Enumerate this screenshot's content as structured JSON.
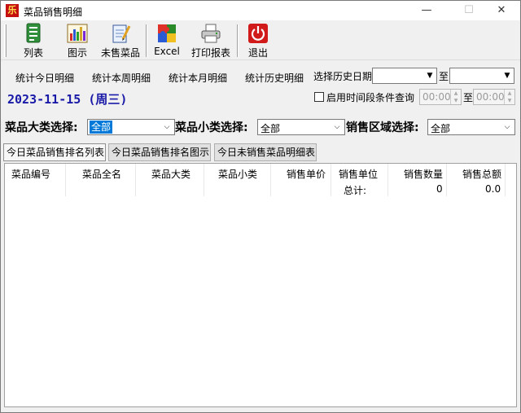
{
  "window": {
    "app_icon_text": "乐",
    "title": "菜品销售明细",
    "min_glyph": "—",
    "max_glyph": "☐",
    "close_glyph": "✕"
  },
  "toolbar": {
    "items": [
      {
        "label": "列表",
        "icon": "list-icon"
      },
      {
        "label": "图示",
        "icon": "bar-chart-icon"
      },
      {
        "label": "未售菜品",
        "icon": "notepad-icon"
      },
      {
        "label": "Excel",
        "icon": "puzzle-icon"
      },
      {
        "label": "打印报表",
        "icon": "printer-icon"
      },
      {
        "label": "退出",
        "icon": "power-icon"
      }
    ]
  },
  "query": {
    "today": "统计今日明细",
    "week": "统计本周明细",
    "month": "统计本月明细",
    "history": "统计历史明细",
    "history_date_label": "选择历史日期",
    "to_label": "至",
    "date_display": "2023-11-15 (周三)",
    "time_range_label": "启用时间段条件查询",
    "time_from": "00:00",
    "time_to": "00:00"
  },
  "filters": {
    "category_label": "菜品大类选择:",
    "category_value": "全部",
    "subcategory_label": "菜品小类选择:",
    "subcategory_value": "全部",
    "region_label": "销售区域选择:",
    "region_value": "全部"
  },
  "reports": {
    "ranking_list": "今日菜品销售排名列表",
    "ranking_chart": "今日菜品销售排名图示",
    "unsold_list": "今日未销售菜品明细表"
  },
  "table": {
    "columns": [
      "菜品编号",
      "菜品全名",
      "菜品大类",
      "菜品小类",
      "销售单价",
      "销售单位",
      "销售数量",
      "销售总额"
    ],
    "total_label": "总计:",
    "total_qty": "0",
    "total_amount": "0.0"
  },
  "colors": {
    "date_text": "#1a1aa8",
    "selection": "#0078d7",
    "exit_icon": "#d11a1a"
  }
}
